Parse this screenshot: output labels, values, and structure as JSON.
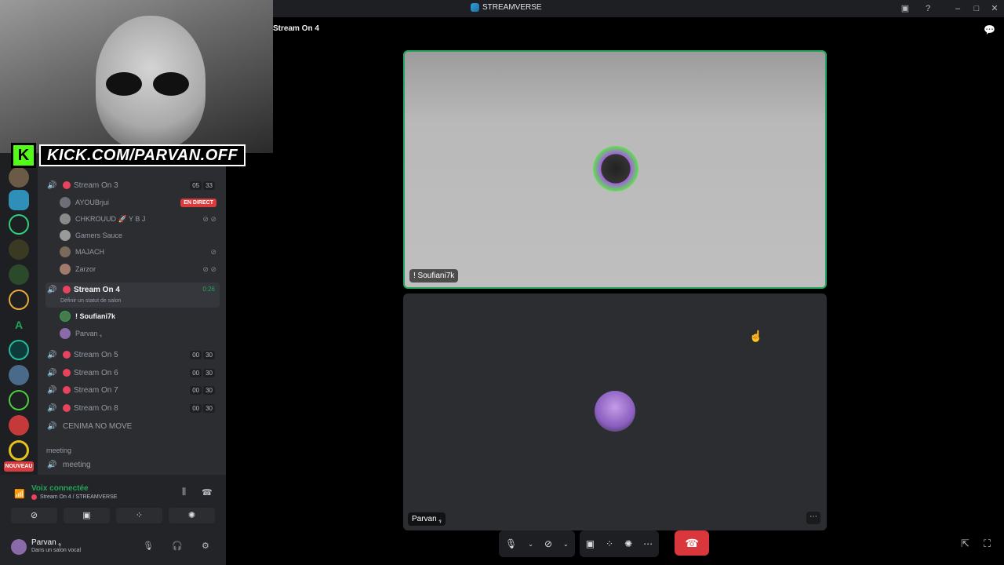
{
  "app": {
    "title": "STREAMVERSE"
  },
  "stage": {
    "title": "Stream On 4"
  },
  "overlay": {
    "kick_letter": "K",
    "kick_url": "KICK.COM/PARVAN.OFF"
  },
  "channels": [
    {
      "name": "Stream On 3",
      "pill1": "05",
      "pill2": "33"
    },
    {
      "name": "Stream On 4",
      "timer": "0:26",
      "status": "Définir un statut de salon"
    },
    {
      "name": "Stream On 5",
      "pill1": "00",
      "pill2": "30"
    },
    {
      "name": "Stream On 6",
      "pill1": "00",
      "pill2": "30"
    },
    {
      "name": "Stream On 7",
      "pill1": "00",
      "pill2": "30"
    },
    {
      "name": "Stream On 8",
      "pill1": "00",
      "pill2": "30"
    },
    {
      "name": "CENIMA NO MOVE"
    }
  ],
  "users_ch3": [
    {
      "name": "AYOUBrjui",
      "badge": "EN DIRECT"
    },
    {
      "name": "CHKROUUD 🚀 Y B J"
    },
    {
      "name": "Gamers Sauce"
    },
    {
      "name": "MAJACH"
    },
    {
      "name": "Zarzor"
    }
  ],
  "users_ch4": [
    {
      "name": "! Soufiani7k"
    },
    {
      "name": "Parvan ﮩ"
    }
  ],
  "category": {
    "name": "meeting"
  },
  "meeting_channel": {
    "name": "meeting"
  },
  "nouveau_badge": "NOUVEAU",
  "voice": {
    "title": "Voix connectée",
    "subtitle": "Stream On 4 / STREAMVERSE"
  },
  "user": {
    "name": "Parvan ﮩ",
    "status": "Dans un salon vocal"
  },
  "tiles": [
    {
      "label": "! Soufiani7k"
    },
    {
      "label": "Parvan ﮩ"
    }
  ],
  "icons": {
    "speaker": "🔊",
    "mic": "🎙",
    "headset": "🎧",
    "settings": "⚙",
    "more": "⋯",
    "hangup": "☎",
    "chat": "💬"
  }
}
